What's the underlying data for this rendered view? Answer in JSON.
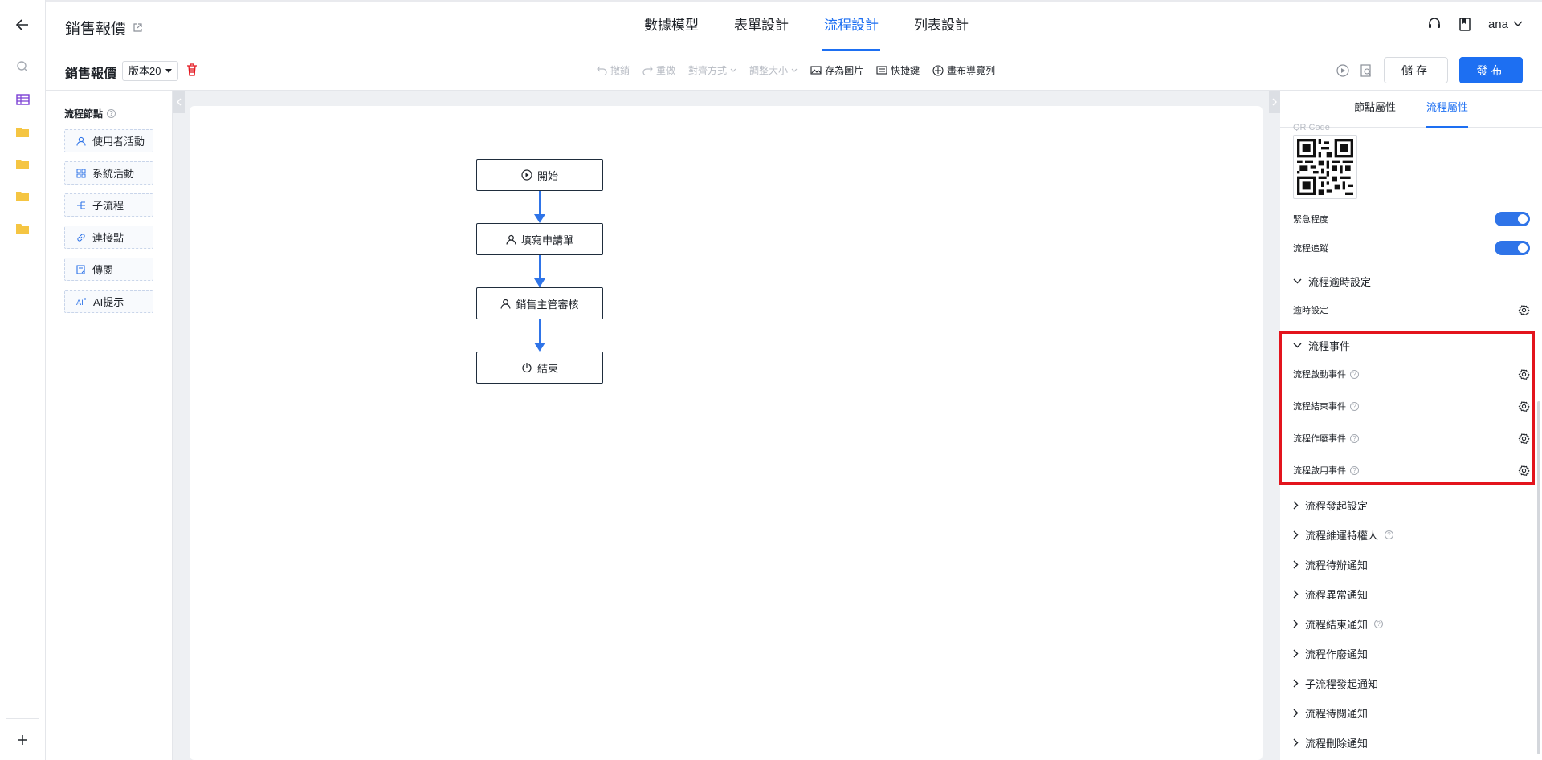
{
  "header": {
    "app_title": "銷售報價",
    "tabs": [
      {
        "label": "數據模型",
        "active": false
      },
      {
        "label": "表單設計",
        "active": false
      },
      {
        "label": "流程設計",
        "active": true
      },
      {
        "label": "列表設計",
        "active": false
      }
    ],
    "user": "ana"
  },
  "toolbar": {
    "title": "銷售報價",
    "version": "版本20",
    "undo": "撤銷",
    "redo": "重做",
    "align": "對齊方式",
    "resize": "調整大小",
    "save_image": "存為圖片",
    "shortcuts": "快捷鍵",
    "canvas_nav": "畫布導覽列",
    "save": "儲存",
    "publish": "發布"
  },
  "palette": {
    "title": "流程節點",
    "items": [
      {
        "label": "使用者活動",
        "icon": "user-icon"
      },
      {
        "label": "系統活動",
        "icon": "grid-icon"
      },
      {
        "label": "子流程",
        "icon": "subflow-icon"
      },
      {
        "label": "連接點",
        "icon": "link-icon"
      },
      {
        "label": "傳閱",
        "icon": "edit-doc-icon"
      },
      {
        "label": "AI提示",
        "icon": "ai-icon"
      }
    ]
  },
  "flow": {
    "nodes": [
      {
        "label": "開始",
        "icon": "play-icon"
      },
      {
        "label": "填寫申請單",
        "icon": "user-icon"
      },
      {
        "label": "銷售主管審核",
        "icon": "user-icon"
      },
      {
        "label": "結束",
        "icon": "power-icon"
      }
    ]
  },
  "props": {
    "tabs": [
      {
        "label": "節點屬性",
        "active": false
      },
      {
        "label": "流程屬性",
        "active": true
      }
    ],
    "qr_label": "QR Code",
    "urgency": "緊急程度",
    "urgency_on": true,
    "tracking": "流程追蹤",
    "tracking_on": true,
    "timeout_section": "流程逾時設定",
    "timeout_setting": "逾時設定",
    "events_section": "流程事件",
    "events": [
      "流程啟動事件",
      "流程結束事件",
      "流程作廢事件",
      "流程啟用事件"
    ],
    "sections": [
      {
        "label": "流程發起設定",
        "help": false
      },
      {
        "label": "流程維運特權人",
        "help": true
      },
      {
        "label": "流程待辦通知",
        "help": false
      },
      {
        "label": "流程異常通知",
        "help": false
      },
      {
        "label": "流程結束通知",
        "help": true
      },
      {
        "label": "流程作廢通知",
        "help": false
      },
      {
        "label": "子流程發起通知",
        "help": false
      },
      {
        "label": "流程待閱通知",
        "help": false
      },
      {
        "label": "流程刪除通知",
        "help": false
      }
    ]
  },
  "colors": {
    "accent": "#1d6ff2",
    "highlight": "#e3141d",
    "folder": "#f5c542"
  }
}
